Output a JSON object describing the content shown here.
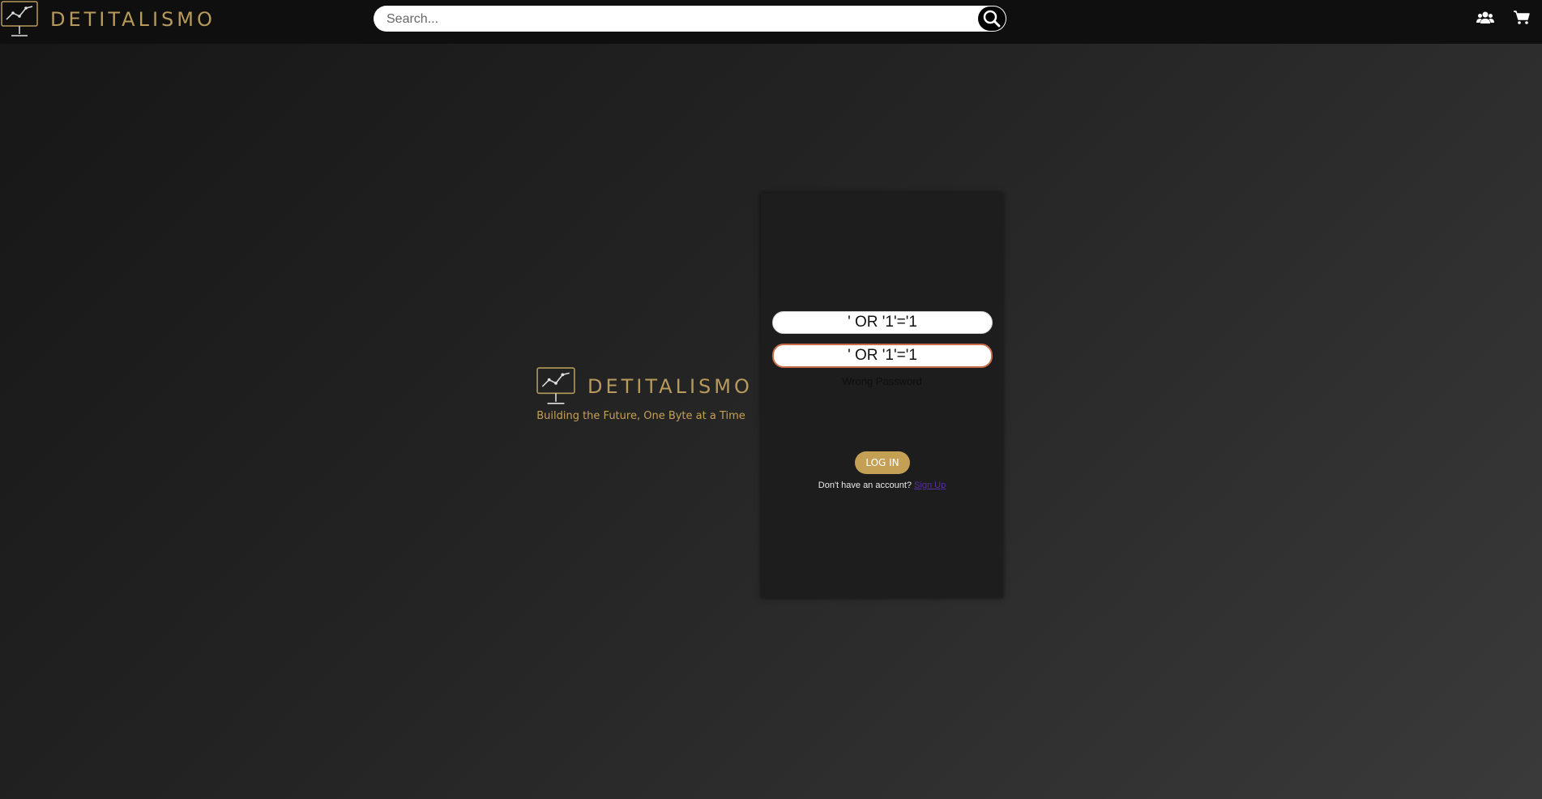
{
  "header": {
    "brand_name": "DETITALISMO",
    "logo_icon": "monitor-chart-icon",
    "search": {
      "placeholder": "Search...",
      "value": ""
    },
    "search_icon": "search-icon",
    "nav_icons": [
      "users-icon",
      "cart-icon"
    ]
  },
  "hero": {
    "brand_name": "DETITALISMO",
    "tagline": "Building the Future, One Byte at a Time"
  },
  "login": {
    "username_value": "' OR '1'='1",
    "password_value": "' OR '1'='1",
    "error_text": "Wrong Password",
    "login_button": "LOG IN",
    "signup_prompt": "Don't have an account?",
    "signup_link": "Sign Up"
  },
  "colors": {
    "gold": "#c4a055",
    "header_bg": "#0f0f0f",
    "card_bg": "#1d1d1d",
    "focus_border": "#c96e4a",
    "link": "#5c2ea0"
  }
}
